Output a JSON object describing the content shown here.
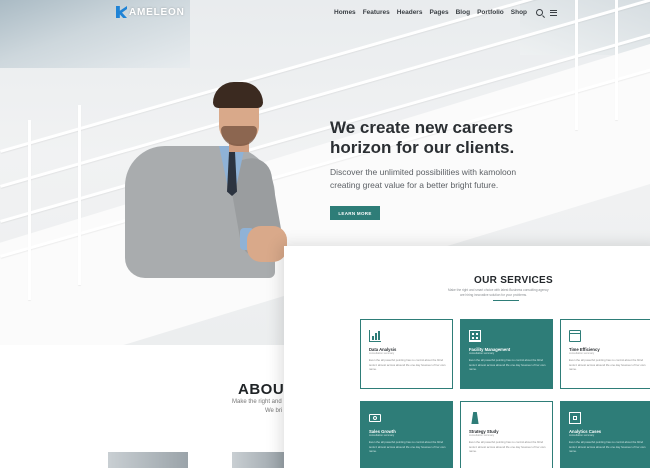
{
  "brand": {
    "logo_text": "AMELEON",
    "accent": "#2e7d78",
    "logo_color": "#1f83d6"
  },
  "nav": {
    "items": [
      "Homes",
      "Features",
      "Headers",
      "Pages",
      "Blog",
      "Portfolio",
      "Shop"
    ],
    "icons": [
      "search-icon",
      "menu-icon"
    ]
  },
  "hero": {
    "title": "We create new careers horizon for our clients.",
    "subtitle": "Discover the unlimited possibilities with kamoloon creating great value for a better bright future.",
    "button": "LEARN MORE"
  },
  "about": {
    "title": "ABOUT",
    "line1": "Make the right and",
    "line2": "We bri"
  },
  "services": {
    "title": "OUR SERVICES",
    "desc_line1": "Make the right and smart choice with latest Business consulting agency",
    "desc_line2": "are hiring innovative solution for your problems.",
    "cards": [
      {
        "title": "Data Analysis",
        "sub": "consultation summary",
        "body": "Even the all powerful pointing has no control about the blind texts it almost across abound life one day however of her own name.",
        "icon": "bar-chart-icon",
        "teal": false
      },
      {
        "title": "Facility Management",
        "sub": "consultation summary",
        "body": "Even the all powerful pointing has no control about the blind texts it almost across abound life one day however of her own name.",
        "icon": "building-icon",
        "teal": true
      },
      {
        "title": "Time Efficiency",
        "sub": "consultation summary",
        "body": "Even the all powerful pointing has no control about the blind texts it almost across abound life one day however of her own name.",
        "icon": "calendar-icon",
        "teal": false
      },
      {
        "title": "Sales Growth",
        "sub": "consultation summary",
        "body": "Even the all powerful pointing has no control about the blind texts it almost across abound life one day however of her own name.",
        "icon": "money-icon",
        "teal": true
      },
      {
        "title": "Strategy Study",
        "sub": "consultation summary",
        "body": "Even the all powerful pointing has no control about the blind texts it almost across abound life one day however of her own name.",
        "icon": "lighthouse-icon",
        "teal": false
      },
      {
        "title": "Analytics Cases",
        "sub": "consultation summary",
        "body": "Even the all powerful pointing has no control about the blind texts it almost across abound life one day however of her own name.",
        "icon": "box-icon",
        "teal": true
      }
    ]
  }
}
